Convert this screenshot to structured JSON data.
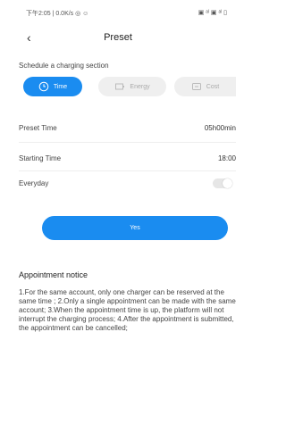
{
  "status_bar": {
    "left": "下午2:05 | 0.0K/s ◎ ☺",
    "right": "▣ ᵃˡ ▣ ᵃˡ ▯"
  },
  "nav": {
    "back_icon": "chevron-left-icon",
    "title": "Preset"
  },
  "schedule": {
    "label": "Schedule a charging section",
    "tabs": [
      {
        "label": "Time",
        "icon": "clock-icon",
        "active": true
      },
      {
        "label": "Energy",
        "icon": "battery-icon",
        "active": false
      },
      {
        "label": "Cost",
        "icon": "cost-icon",
        "active": false
      }
    ]
  },
  "rows": {
    "preset_time": {
      "label": "Preset Time",
      "value": "05h00min"
    },
    "starting_time": {
      "label": "Starting Time",
      "value": "18:00"
    },
    "everyday": {
      "label": "Everyday",
      "enabled": false
    }
  },
  "actions": {
    "yes_label": "Yes"
  },
  "notice": {
    "title": "Appointment notice",
    "text": "1.For the same account, only one charger can be reserved at the same time ; 2.Only a single appointment can be made with the same account; 3.When the appointment time is up, the platform will not interrupt the charging process; 4.After the appointment is submitted, the appointment can be cancelled;"
  },
  "colors": {
    "accent": "#1a8cf0",
    "inactive_tab": "#efefef"
  }
}
